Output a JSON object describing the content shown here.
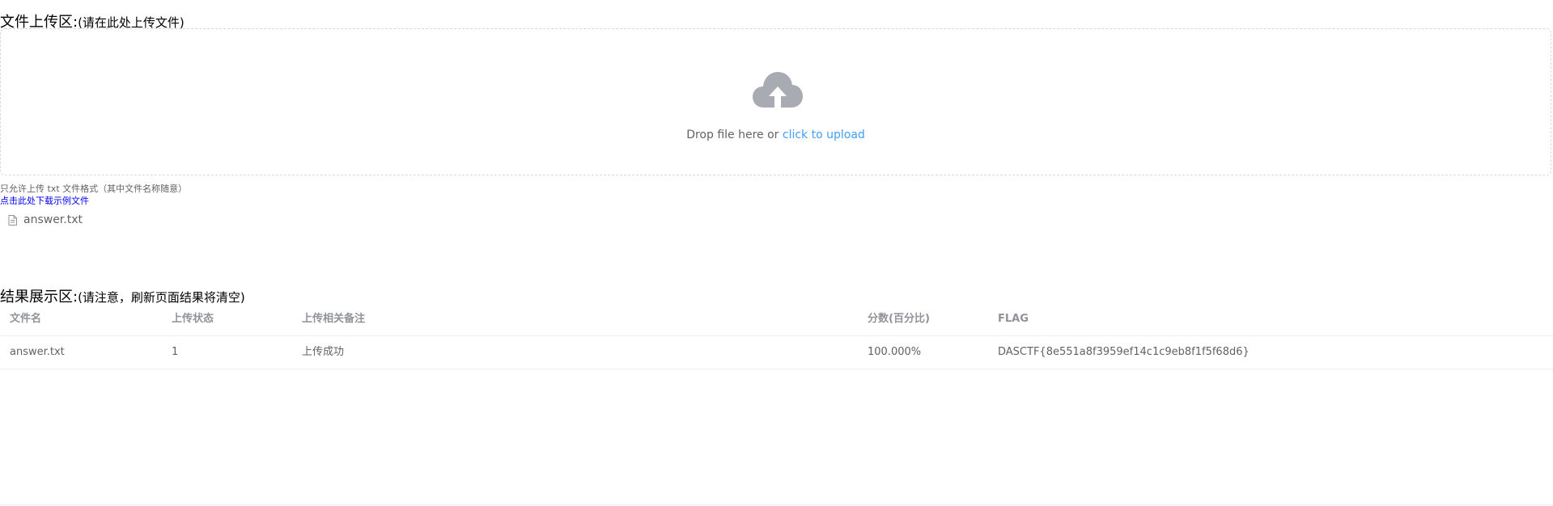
{
  "upload_section": {
    "title": "文件上传区:",
    "subtitle": "(请在此处上传文件)"
  },
  "dropzone": {
    "icon": "cloud-upload-icon",
    "text": "Drop file here or ",
    "link_text": "click to upload"
  },
  "tip": "只允许上传 txt 文件格式（其中文件名称随意）",
  "download_link": "点击此处下载示例文件",
  "file_list": [
    {
      "icon": "document-icon",
      "name": "answer.txt"
    }
  ],
  "results_section": {
    "title": "结果展示区:",
    "subtitle": "(请注意，刷新页面结果将清空)"
  },
  "table": {
    "headers": [
      "文件名",
      "上传状态",
      "上传相关备注",
      "分数(百分比)",
      "FLAG"
    ],
    "rows": [
      [
        "answer.txt",
        "1",
        "上传成功",
        "100.000%",
        "DASCTF{8e551a8f3959ef14c1c9eb8f1f5f68d6}"
      ]
    ]
  },
  "colors": {
    "link": "#409eff",
    "icon": "#a8abb2",
    "border": "#d9d9d9"
  }
}
